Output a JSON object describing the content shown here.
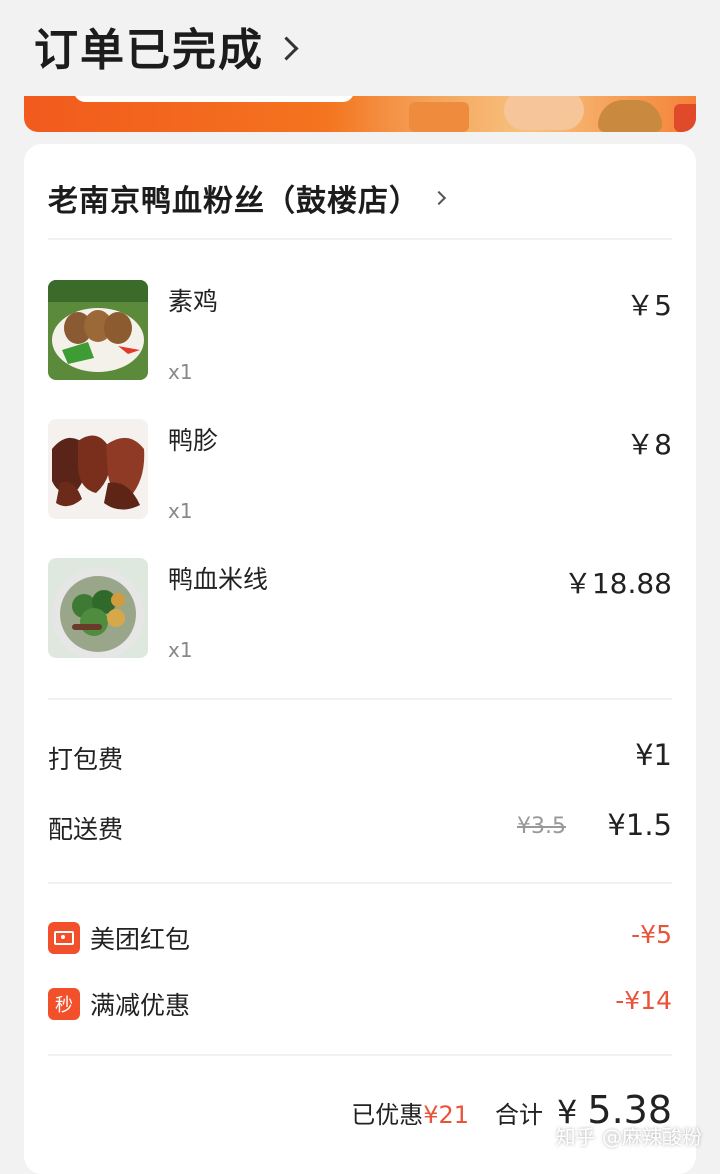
{
  "header": {
    "title": "订单已完成"
  },
  "store": {
    "name": "老南京鸭血粉丝（鼓楼店）"
  },
  "items": [
    {
      "name": "素鸡",
      "qty": "x1",
      "price": "￥5"
    },
    {
      "name": "鸭胗",
      "qty": "x1",
      "price": "￥8"
    },
    {
      "name": "鸭血米线",
      "qty": "x1",
      "price": "￥18.88"
    }
  ],
  "fees": {
    "packing": {
      "label": "打包费",
      "value": "¥1"
    },
    "delivery": {
      "label": "配送费",
      "original": "¥3.5",
      "value": "¥1.5"
    }
  },
  "discounts": [
    {
      "icon": "red-envelope-icon",
      "label": "美团红包",
      "value": "-¥5"
    },
    {
      "icon": "秒",
      "label": "满减优惠",
      "value": "-¥14"
    }
  ],
  "summary": {
    "saved_label": "已优惠",
    "saved_value": "¥21",
    "total_label": "合计",
    "total_currency": "¥",
    "total_value": "5.38"
  },
  "watermark": "知乎 @麻辣酸粉",
  "colors": {
    "accent": "#f2502b",
    "discount_text": "#e8533a",
    "background": "#f2f2f2"
  }
}
